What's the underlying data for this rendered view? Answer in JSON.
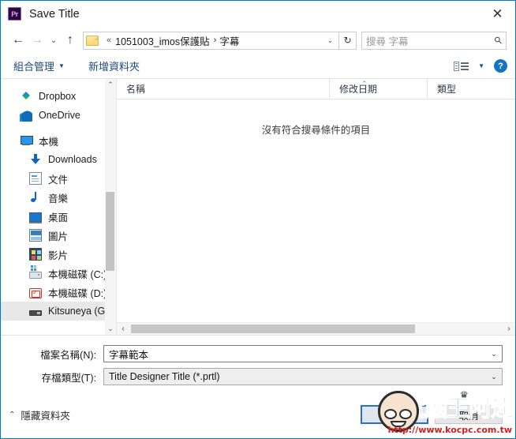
{
  "window": {
    "title": "Save Title",
    "app_icon": "premiere-pro-icon",
    "app_icon_text": "Pr",
    "close_label": "✕",
    "accent_color": "#0078d7"
  },
  "navbar": {
    "back_icon": "←",
    "forward_icon": "→",
    "history_icon": "⌄",
    "up_icon": "↑",
    "breadcrumb": {
      "overflow": "«",
      "items": [
        "1051003_imos保護貼",
        "字幕"
      ],
      "separator": "›"
    },
    "dropdown_icon": "⌄",
    "refresh_icon": "↻",
    "search_placeholder": "搜尋 字幕",
    "search_value": "",
    "search_icon": "⚲"
  },
  "toolbar": {
    "organize_label": "組合管理",
    "new_folder_label": "新增資料夾",
    "caret": "▼",
    "view_icon": "view-options-icon",
    "help_label": "?"
  },
  "sidebar": {
    "items": [
      {
        "label": "Dropbox",
        "icon": "dropbox-icon",
        "indent": false,
        "selected": false
      },
      {
        "label": "OneDrive",
        "icon": "onedrive-icon",
        "indent": false,
        "selected": false
      },
      {
        "label": "本機",
        "icon": "this-pc-icon",
        "indent": false,
        "selected": false
      },
      {
        "label": "Downloads",
        "icon": "downloads-icon",
        "indent": true,
        "selected": false
      },
      {
        "label": "文件",
        "icon": "documents-icon",
        "indent": true,
        "selected": false
      },
      {
        "label": "音樂",
        "icon": "music-icon",
        "indent": true,
        "selected": false
      },
      {
        "label": "桌面",
        "icon": "desktop-icon",
        "indent": true,
        "selected": false
      },
      {
        "label": "圖片",
        "icon": "pictures-icon",
        "indent": true,
        "selected": false
      },
      {
        "label": "影片",
        "icon": "videos-icon",
        "indent": true,
        "selected": false
      },
      {
        "label": "本機磁碟 (C:)",
        "icon": "local-disk-c-icon",
        "indent": true,
        "selected": false
      },
      {
        "label": "本機磁碟 (D:)",
        "icon": "local-disk-d-icon",
        "indent": true,
        "selected": false
      },
      {
        "label": "Kitsuneya (G:)",
        "icon": "removable-drive-icon",
        "indent": true,
        "selected": true
      }
    ],
    "scroll_up_icon": "⌃",
    "scroll_down_icon": "⌄"
  },
  "filelist": {
    "columns": [
      "名稱",
      "修改日期",
      "類型"
    ],
    "sort_indicator": "⌃",
    "rows": [],
    "empty_message": "沒有符合搜尋條件的項目",
    "hscroll_left_icon": "‹",
    "hscroll_right_icon": "›"
  },
  "form": {
    "filename_label": "檔案名稱(N):",
    "filename_value": "字幕範本",
    "filetype_label": "存檔類型(T):",
    "filetype_value": "Title Designer Title (*.prtl)",
    "dropdown_icon": "⌄"
  },
  "footer": {
    "hide_folders_label": "隱藏資料夾",
    "collapse_icon": "⌃",
    "save_label": "存檔(S)",
    "cancel_label": "取消"
  },
  "watermark": {
    "brand": "電腦王阿達",
    "url": "http://www.kocpc.com.tw",
    "crown_icon": "♛"
  }
}
